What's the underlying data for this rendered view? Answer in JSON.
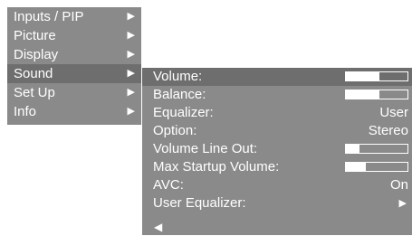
{
  "main_menu": {
    "items": [
      {
        "label": "Inputs / PIP",
        "arrow": "▶",
        "selected": false
      },
      {
        "label": "Picture",
        "arrow": "▶",
        "selected": false
      },
      {
        "label": "Display",
        "arrow": "▶",
        "selected": false
      },
      {
        "label": "Sound",
        "arrow": "▶",
        "selected": true
      },
      {
        "label": "Set Up",
        "arrow": "▶",
        "selected": false
      },
      {
        "label": "Info",
        "arrow": "▶",
        "selected": false
      }
    ]
  },
  "sound_menu": {
    "volume": {
      "label": "Volume:",
      "level": 0.55
    },
    "balance": {
      "label": "Balance:",
      "level": 0.55
    },
    "equalizer": {
      "label": "Equalizer:",
      "value": "User"
    },
    "option": {
      "label": "Option:",
      "value": "Stereo"
    },
    "volume_line_out": {
      "label": "Volume Line Out:",
      "level": 0.22
    },
    "max_startup_volume": {
      "label": "Max Startup Volume:",
      "level": 0.33
    },
    "avc": {
      "label": "AVC:",
      "value": "On"
    },
    "user_equalizer": {
      "label": "User Equalizer:",
      "arrow": "▶"
    },
    "back_arrow": "◀"
  },
  "colors": {
    "menu_bg": "#8a8a8a",
    "selected_bg": "#6e6e6e",
    "text": "#ffffff"
  }
}
